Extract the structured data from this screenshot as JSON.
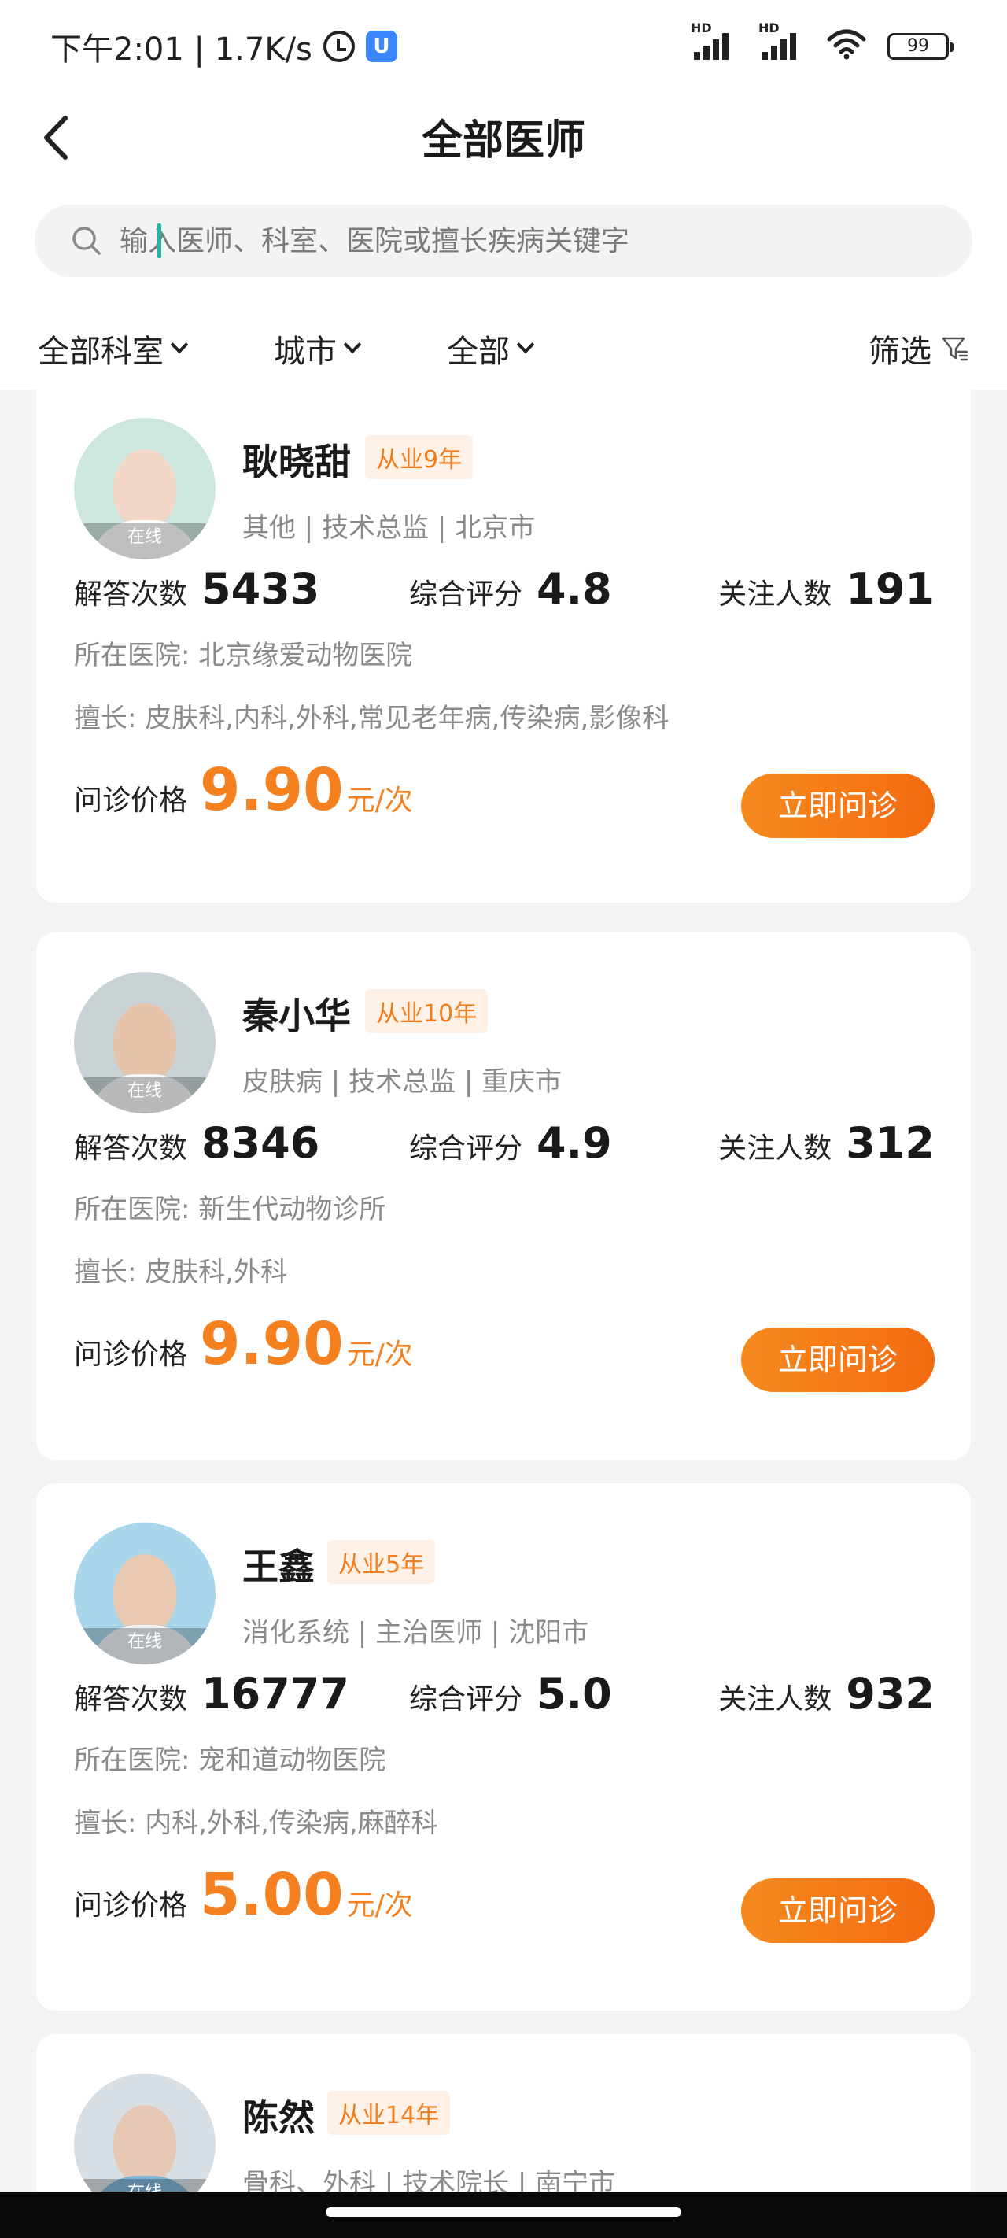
{
  "status_bar": {
    "time_speed": "下午2:01 | 1.7K/s",
    "app_badge": "U",
    "sim1_label": "HD",
    "sim2_label": "HD",
    "battery": "99"
  },
  "header": {
    "title": "全部医师"
  },
  "search": {
    "placeholder": "输入医师、科室、医院或擅长疾病关键字"
  },
  "filters": {
    "department": "全部科室",
    "city": "城市",
    "all": "全部",
    "screen": "筛选"
  },
  "labels": {
    "answers": "解答次数",
    "rating": "综合评分",
    "followers": "关注人数",
    "price": "问诊价格",
    "price_unit": "元/次",
    "consult": "立即问诊",
    "online": "在线"
  },
  "doctors": [
    {
      "name": "耿晓甜",
      "experience": "从业9年",
      "meta": "其他 | 技术总监 | 北京市",
      "answers": "5433",
      "rating": "4.8",
      "followers": "191",
      "hospital": "所在医院: 北京缘爱动物医院",
      "specialty": "擅长: 皮肤科,内科,外科,常见老年病,传染病,影像科",
      "price": "9.90"
    },
    {
      "name": "秦小华",
      "experience": "从业10年",
      "meta": "皮肤病 | 技术总监 | 重庆市",
      "answers": "8346",
      "rating": "4.9",
      "followers": "312",
      "hospital": "所在医院: 新生代动物诊所",
      "specialty": "擅长: 皮肤科,外科",
      "price": "9.90"
    },
    {
      "name": "王鑫",
      "experience": "从业5年",
      "meta": "消化系统 | 主治医师 | 沈阳市",
      "answers": "16777",
      "rating": "5.0",
      "followers": "932",
      "hospital": "所在医院: 宠和道动物医院",
      "specialty": "擅长: 内科,外科,传染病,麻醉科",
      "price": "5.00"
    },
    {
      "name": "陈然",
      "experience": "从业14年",
      "meta": "骨科、外科 | 技术院长 | 南宁市"
    }
  ],
  "colors": {
    "accent": "#f5801f",
    "badge_bg": "#fff1e6",
    "caret": "#1db7a5"
  }
}
